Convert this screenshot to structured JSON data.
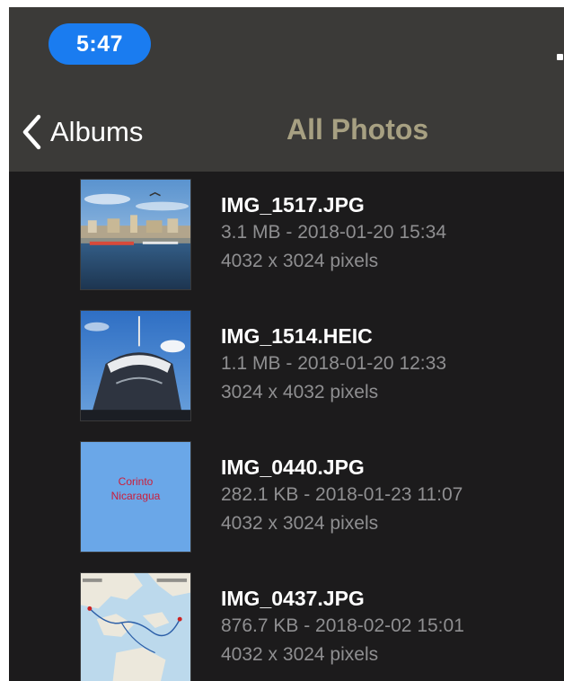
{
  "status_bar": {
    "time": "5:47",
    "time_pill_color": "#1a7cf0"
  },
  "nav": {
    "back_label": "Albums",
    "back_icon": "chevron-left-icon",
    "title": "All Photos",
    "title_color": "#a7a082"
  },
  "photos": [
    {
      "filename": "IMG_1517.JPG",
      "size_date": "3.1 MB - 2018-01-20 15:34",
      "dimensions": "4032 x 3024 pixels",
      "thumbnail": "harbor-photo"
    },
    {
      "filename": "IMG_1514.HEIC",
      "size_date": "1.1 MB - 2018-01-20 12:33",
      "dimensions": "3024 x 4032 pixels",
      "thumbnail": "ship-photo"
    },
    {
      "filename": "IMG_0440.JPG",
      "size_date": "282.1 KB - 2018-01-23 11:07",
      "dimensions": "4032 x 3024 pixels",
      "thumbnail": "text-card",
      "thumbnail_text": [
        "Corinto",
        "Nicaragua"
      ]
    },
    {
      "filename": "IMG_0437.JPG",
      "size_date": "876.7 KB - 2018-02-02 15:01",
      "dimensions": "4032 x 3024 pixels",
      "thumbnail": "map-image"
    }
  ]
}
